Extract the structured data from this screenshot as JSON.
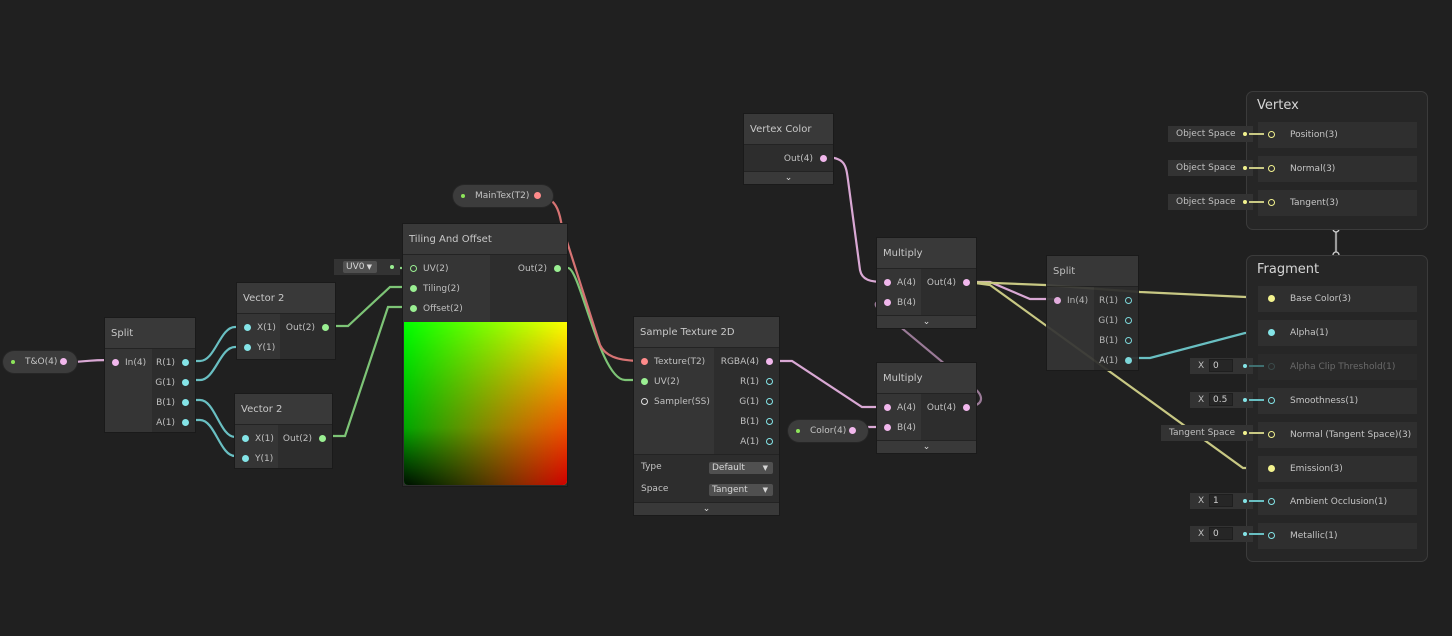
{
  "properties": {
    "to": {
      "label": "T&O(4)"
    },
    "maintex": {
      "label": "MainTex(T2)"
    },
    "color": {
      "label": "Color(4)"
    }
  },
  "nodes": {
    "split1": {
      "title": "Split",
      "inputs": [
        "In(4)"
      ],
      "outputs": [
        "R(1)",
        "G(1)",
        "B(1)",
        "A(1)"
      ]
    },
    "vector2a": {
      "title": "Vector 2",
      "inputs": [
        "X(1)",
        "Y(1)"
      ],
      "outputs": [
        "Out(2)"
      ]
    },
    "vector2b": {
      "title": "Vector 2",
      "inputs": [
        "X(1)",
        "Y(1)"
      ],
      "outputs": [
        "Out(2)"
      ]
    },
    "tiling": {
      "title": "Tiling And Offset",
      "inputs": [
        "UV(2)",
        "Tiling(2)",
        "Offset(2)"
      ],
      "outputs": [
        "Out(2)"
      ],
      "uv_channel": "UV0"
    },
    "sample": {
      "title": "Sample Texture 2D",
      "inputs": [
        "Texture(T2)",
        "UV(2)",
        "Sampler(SS)"
      ],
      "outputs": [
        "RGBA(4)",
        "R(1)",
        "G(1)",
        "B(1)",
        "A(1)"
      ],
      "type_label": "Type",
      "type_value": "Default",
      "space_label": "Space",
      "space_value": "Tangent"
    },
    "vertexcolor": {
      "title": "Vertex Color",
      "outputs": [
        "Out(4)"
      ]
    },
    "multiply1": {
      "title": "Multiply",
      "inputs": [
        "A(4)",
        "B(4)"
      ],
      "outputs": [
        "Out(4)"
      ]
    },
    "multiply2": {
      "title": "Multiply",
      "inputs": [
        "A(4)",
        "B(4)"
      ],
      "outputs": [
        "Out(4)"
      ]
    },
    "split2": {
      "title": "Split",
      "inputs": [
        "In(4)"
      ],
      "outputs": [
        "R(1)",
        "G(1)",
        "B(1)",
        "A(1)"
      ]
    }
  },
  "master": {
    "vertex": {
      "title": "Vertex",
      "slots": [
        {
          "label": "Position(3)",
          "default": "Object Space"
        },
        {
          "label": "Normal(3)",
          "default": "Object Space"
        },
        {
          "label": "Tangent(3)",
          "default": "Object Space"
        }
      ]
    },
    "fragment": {
      "title": "Fragment",
      "slots": [
        {
          "label": "Base Color(3)"
        },
        {
          "label": "Alpha(1)"
        },
        {
          "label": "Alpha Clip Threshold(1)",
          "axis": "X",
          "value": "0",
          "disabled": true
        },
        {
          "label": "Smoothness(1)",
          "axis": "X",
          "value": "0.5"
        },
        {
          "label": "Normal (Tangent Space)(3)",
          "default": "Tangent Space"
        },
        {
          "label": "Emission(3)"
        },
        {
          "label": "Ambient Occlusion(1)",
          "axis": "X",
          "value": "1"
        },
        {
          "label": "Metallic(1)",
          "axis": "X",
          "value": "0"
        }
      ]
    }
  },
  "icons": {
    "chevron": "⌄",
    "dropdown_arrow": "▼"
  },
  "colors": {
    "background": "#202020",
    "wire_vec1": "#84e4e7",
    "wire_vec2": "#9aef92",
    "wire_vec3": "#f2f28e",
    "wire_vec4": "#f1b7ec",
    "wire_texture": "#ff8b8b"
  }
}
